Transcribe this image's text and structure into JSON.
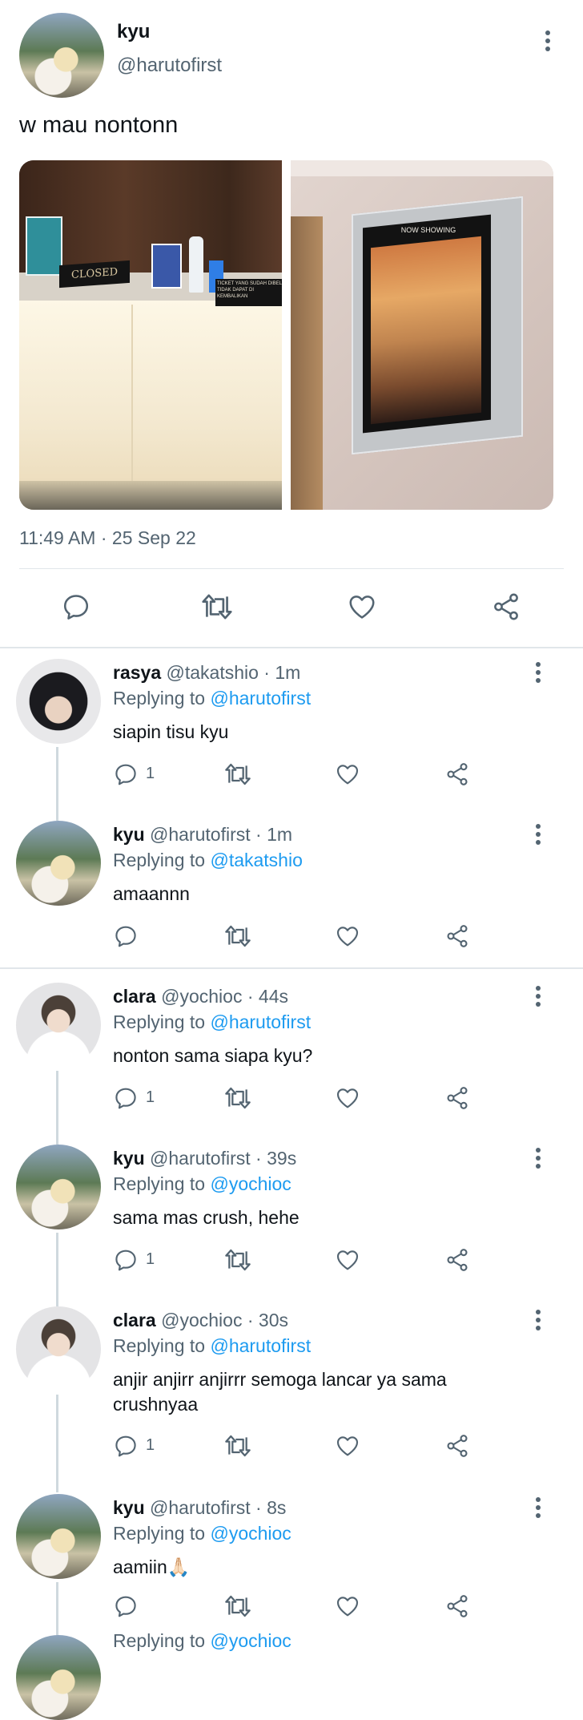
{
  "main_tweet": {
    "name": "kyu",
    "handle": "@harutofirst",
    "text": "w mau nontonn",
    "timestamp": "11:49 AM · 25 Sep 22",
    "images": [
      {
        "desc_labels": [
          "CLOSED",
          "TICKET YANG SUDAH DIBELI TIDAK DAPAT DI KEMBALIKAN"
        ]
      },
      {
        "desc_labels": [
          "NOW SHOWING"
        ]
      }
    ]
  },
  "replies": [
    {
      "name": "rasya",
      "handle": "@takatshio",
      "time": "1m",
      "replying_prefix": "Replying to ",
      "replying_to": "@harutofirst",
      "text": "siapin tisu kyu",
      "reply_count": "1"
    },
    {
      "name": "kyu",
      "handle": "@harutofirst",
      "time": "1m",
      "replying_prefix": "Replying to ",
      "replying_to": "@takatshio",
      "text": "amaannn",
      "reply_count": ""
    },
    {
      "name": "clara",
      "handle": "@yochioc",
      "time": "44s",
      "replying_prefix": "Replying to ",
      "replying_to": "@harutofirst",
      "text": "nonton sama siapa kyu?",
      "reply_count": "1"
    },
    {
      "name": "kyu",
      "handle": "@harutofirst",
      "time": "39s",
      "replying_prefix": "Replying to ",
      "replying_to": "@yochioc",
      "text": "sama mas crush, hehe",
      "reply_count": "1"
    },
    {
      "name": "clara",
      "handle": "@yochioc",
      "time": "30s",
      "replying_prefix": "Replying to ",
      "replying_to": "@harutofirst",
      "text": "anjir anjirr anjirrr semoga lancar ya sama crushnyaa",
      "reply_count": "1"
    },
    {
      "name": "kyu",
      "handle": "@harutofirst",
      "time": "8s",
      "replying_prefix": "Replying to ",
      "replying_to": "@yochioc",
      "text": "aamiin🙏🏻",
      "reply_count": ""
    }
  ],
  "partial_bottom": {
    "replying_prefix": "Replying to ",
    "replying_to": "@yochioc"
  },
  "separator": " · ",
  "icons": {
    "reply": "reply-icon",
    "retweet": "retweet-icon",
    "like": "heart-icon",
    "share": "share-icon",
    "more": "more-icon"
  },
  "colors": {
    "text": "#0f1419",
    "secondary": "#536471",
    "accent": "#1d9bf0",
    "divider": "#e1e6ea"
  }
}
